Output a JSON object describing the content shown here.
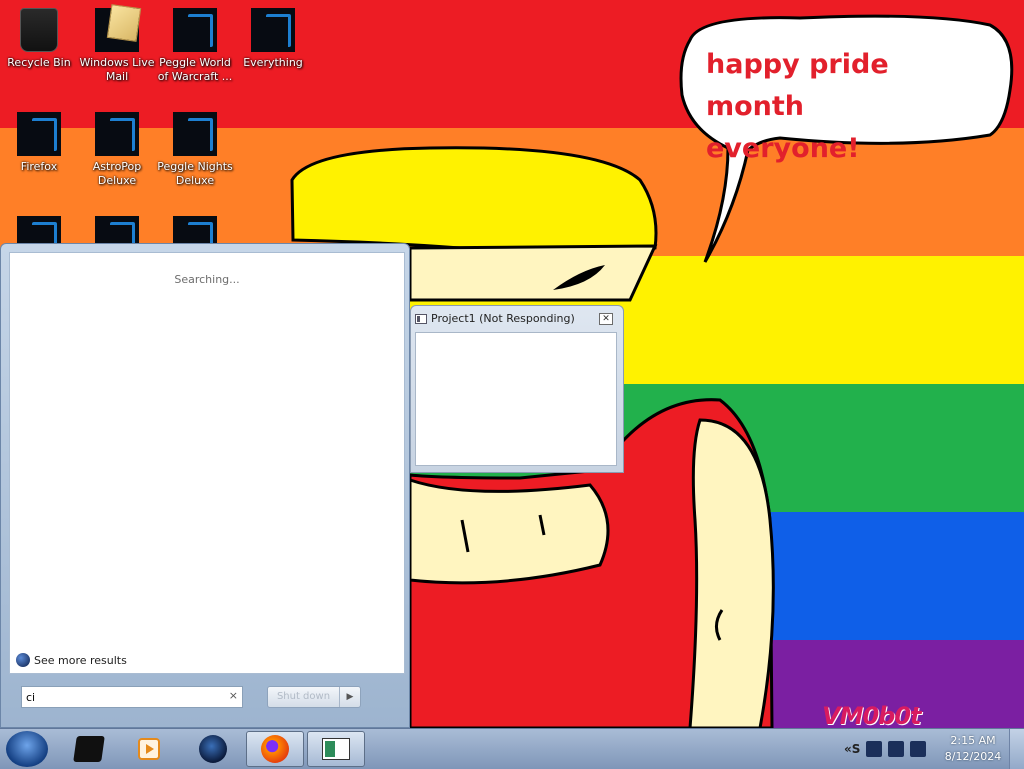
{
  "desktop": {
    "bubble_line1": "happy pride month",
    "bubble_line2": "everyone!",
    "watermark": "VM0b0t",
    "icons": [
      {
        "label": "Recycle Bin",
        "icon": "recycle-bin-icon"
      },
      {
        "label": "Windows Live Mail",
        "icon": "mail-icon"
      },
      {
        "label": "Peggle World of Warcraft ...",
        "icon": "game-icon"
      },
      {
        "label": "Everything",
        "icon": "app-icon"
      },
      {
        "label": "Firefox",
        "icon": "firefox-icon"
      },
      {
        "label": "AstroPop Deluxe",
        "icon": "game-icon"
      },
      {
        "label": "Peggle Nights Deluxe",
        "icon": "game-icon"
      }
    ]
  },
  "start_menu": {
    "status": "Searching...",
    "see_more": "See more results",
    "search_value": "ci",
    "clear_glyph": "×",
    "shutdown_label": "Shut down",
    "shutdown_arrow": "▶"
  },
  "window": {
    "title": "Project1 (Not Responding)",
    "close_glyph": "✕"
  },
  "taskbar": {
    "items": [
      "file-explorer-icon",
      "media-player-icon",
      "internet-explorer-icon",
      "firefox-icon",
      "project1-icon"
    ],
    "tray_expand": "«S",
    "time": "2:15 AM",
    "date": "8/12/2024"
  },
  "colors": {
    "red": "#ed1c24",
    "orange": "#ff7f27",
    "yellow": "#fff200",
    "green": "#22b14c",
    "blue": "#0f5fe8",
    "purple": "#7b1fa2",
    "bubble_text": "#e2202c"
  }
}
